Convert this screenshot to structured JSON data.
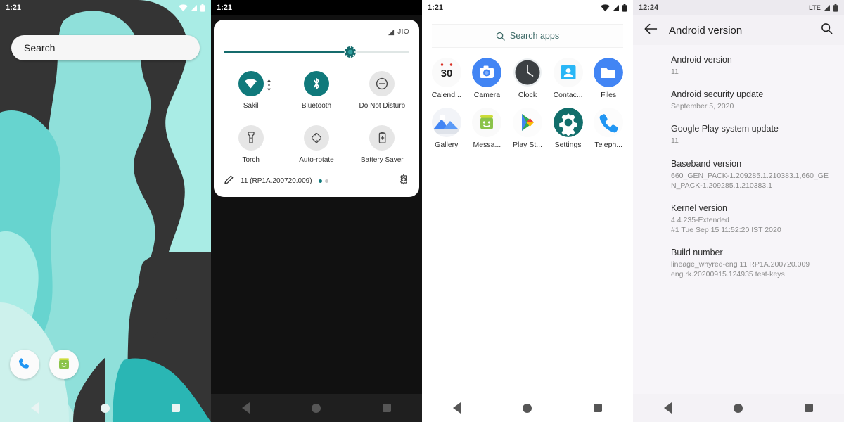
{
  "home": {
    "statusbar": {
      "time": "1:21",
      "icons": [
        "wifi-icon",
        "signal-icon",
        "battery-icon"
      ]
    },
    "search_placeholder": "Search",
    "dock": [
      {
        "name": "phone-app-icon",
        "label": "Phone"
      },
      {
        "name": "messaging-app-icon",
        "label": "Messaging"
      }
    ],
    "wallpaper_colors": {
      "dark": "#343434",
      "teal_light": "#aceae2",
      "teal_mid": "#8fe0da",
      "teal_deep": "#43c2bd"
    }
  },
  "quicksettings": {
    "statusbar": {
      "time": "1:21"
    },
    "carrier": "JIO",
    "brightness_percent": 68,
    "tiles": [
      {
        "label": "Sakil",
        "icon": "wifi-icon",
        "state": "on"
      },
      {
        "label": "Bluetooth",
        "icon": "bluetooth-icon",
        "state": "on"
      },
      {
        "label": "Do Not Disturb",
        "icon": "do-not-disturb-icon",
        "state": "off"
      },
      {
        "label": "Torch",
        "icon": "flashlight-icon",
        "state": "off"
      },
      {
        "label": "Auto-rotate",
        "icon": "auto-rotate-icon",
        "state": "off"
      },
      {
        "label": "Battery Saver",
        "icon": "battery-saver-icon",
        "state": "off"
      }
    ],
    "footer": {
      "build": "11 (RP1A.200720.009)",
      "edit_icon": "pencil-icon",
      "settings_icon": "gear-icon",
      "pages": 2,
      "active_page": 1
    },
    "accent_color": "#10797b"
  },
  "appdrawer": {
    "statusbar": {
      "time": "1:21"
    },
    "search_placeholder": "Search apps",
    "rows": [
      [
        {
          "label": "Calend...",
          "icon": "calendar-app-icon"
        },
        {
          "label": "Camera",
          "icon": "camera-app-icon"
        },
        {
          "label": "Clock",
          "icon": "clock-app-icon"
        },
        {
          "label": "Contac...",
          "icon": "contacts-app-icon"
        },
        {
          "label": "Files",
          "icon": "files-app-icon"
        }
      ],
      [
        {
          "label": "Gallery",
          "icon": "gallery-app-icon"
        },
        {
          "label": "Messa...",
          "icon": "messaging-app-icon"
        },
        {
          "label": "Play St...",
          "icon": "play-store-app-icon"
        },
        {
          "label": "Settings",
          "icon": "settings-app-icon"
        },
        {
          "label": "Teleph...",
          "icon": "telephony-app-icon"
        }
      ]
    ]
  },
  "androidversion": {
    "statusbar": {
      "time": "12:24",
      "network": "LTE"
    },
    "title": "Android version",
    "back_icon": "back-arrow-icon",
    "search_icon": "search-icon",
    "items": [
      {
        "head": "Android version",
        "sub": "11"
      },
      {
        "head": "Android security update",
        "sub": "September 5, 2020"
      },
      {
        "head": "Google Play system update",
        "sub": "11"
      },
      {
        "head": "Baseband version",
        "sub": "660_GEN_PACK-1.209285.1.210383.1,660_GEN_PACK-1.209285.1.210383.1"
      },
      {
        "head": "Kernel version",
        "sub": "4.4.235-Extended\n#1 Tue Sep 15 11:52:20 IST 2020"
      },
      {
        "head": "Build number",
        "sub": "lineage_whyred-eng 11 RP1A.200720.009 eng.rk.20200915.124935 test-keys"
      }
    ]
  },
  "navbar": {
    "back": "back-triangle-icon",
    "home": "home-circle-icon",
    "recents": "recents-square-icon"
  }
}
